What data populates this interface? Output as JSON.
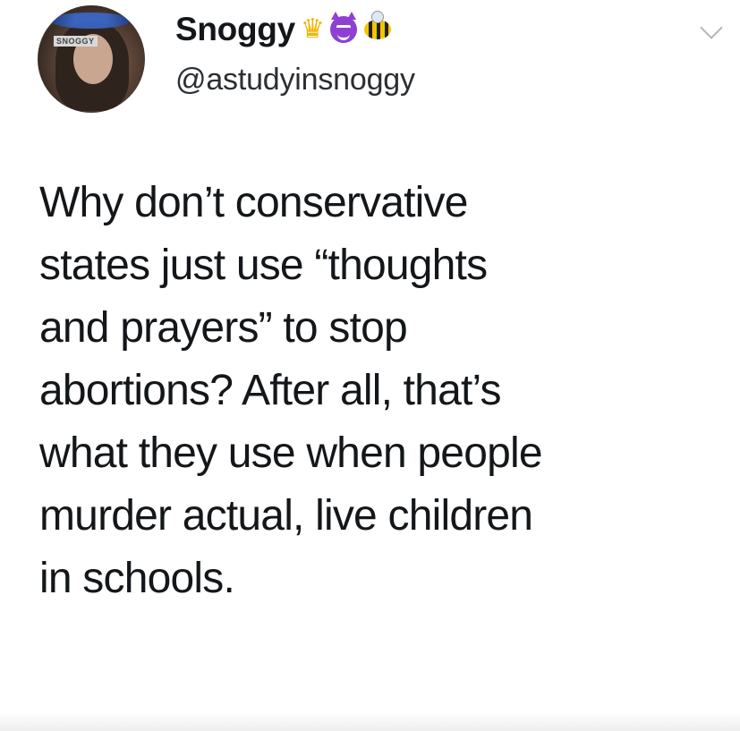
{
  "author": {
    "display_name": "Snoggy",
    "handle": "@astudyinsnoggy",
    "avatar_tag": "SNOGGY",
    "name_emojis": [
      "crown-emoji",
      "smiling-devil-emoji",
      "bee-emoji"
    ]
  },
  "menu": {
    "icon": "chevron-down-icon"
  },
  "tweet": {
    "lines": [
      "Why don’t conservative",
      "states just use “thoughts",
      "and prayers” to stop",
      "abortions? After all, that’s",
      "what they use when people",
      "murder actual, live children",
      "in schools."
    ]
  },
  "colors": {
    "text": "#14171a",
    "handle": "#2b2f33",
    "chevron": "#b0b6bb"
  }
}
